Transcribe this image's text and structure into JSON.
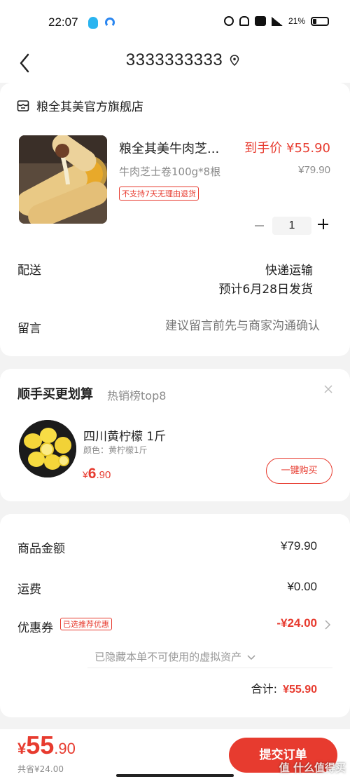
{
  "status_bar": {
    "time": "22:07",
    "battery": "21%"
  },
  "nav": {
    "title": "3333333333"
  },
  "store": {
    "name": "粮全其美官方旗舰店"
  },
  "product": {
    "title": "粮全其美牛肉芝...",
    "price": "到手价 ¥55.90",
    "spec": "牛肉芝士卷100g*8根",
    "original_price": "¥79.90",
    "tag": "不支持7天无理由退货",
    "quantity": "1"
  },
  "delivery": {
    "label": "配送",
    "method": "快递运输",
    "estimate": "预计6月28日发货"
  },
  "note": {
    "label": "留言",
    "placeholder": "建议留言前先与商家沟通确认"
  },
  "addon": {
    "title": "顺手买更划算",
    "subtitle": "热销榜top8",
    "item_name": "四川黄柠檬 1斤",
    "item_spec": "颜色：黄柠檬1斤",
    "price_currency": "¥",
    "price_main": "6",
    "price_decimal": ".90",
    "buy_label": "一键购买"
  },
  "summary": {
    "goods_label": "商品金额",
    "goods_value": "¥79.90",
    "shipping_label": "运费",
    "shipping_value": "¥0.00",
    "coupon_label": "优惠券",
    "coupon_tag": "已选推荐优惠",
    "coupon_value": "-¥24.00",
    "hidden_assets": "已隐藏本单不可使用的虚拟资产",
    "total_label": "合计:",
    "total_value": "¥55.90"
  },
  "bottom_bar": {
    "price_currency": "¥",
    "price_main": "55",
    "price_decimal": ".90",
    "discount_text": "共省¥24.00",
    "submit_label": "提交订单"
  },
  "watermark": "值 什么值得买",
  "colors": {
    "accent": "#e73b2f",
    "background": "#f3f3f3"
  },
  "icons": [
    "back-arrow-icon",
    "location-pin-icon",
    "store-icon",
    "close-icon",
    "chevron-right-icon",
    "chevron-down-icon"
  ]
}
